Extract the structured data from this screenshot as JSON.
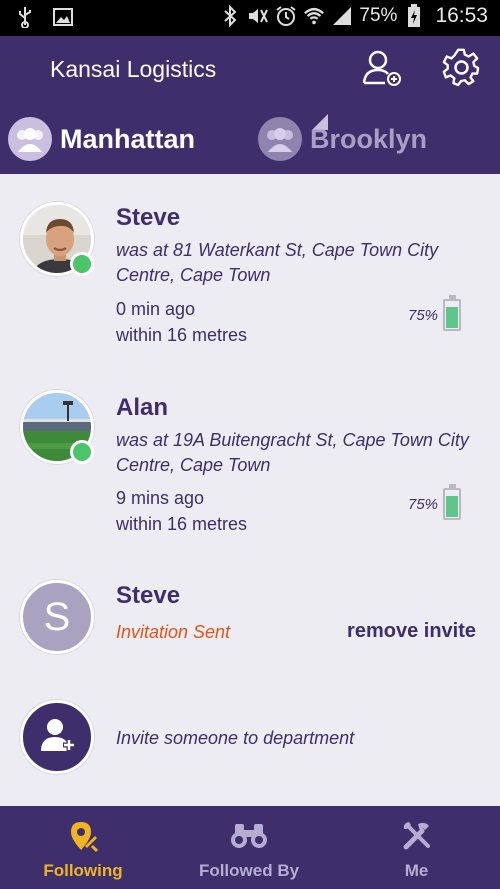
{
  "status_bar": {
    "battery": "75%",
    "time": "16:53"
  },
  "header": {
    "org_name": "Kansai Logistics"
  },
  "tabs": [
    {
      "label": "Manhattan",
      "active": true
    },
    {
      "label": "Brooklyn",
      "active": false
    }
  ],
  "people": [
    {
      "name": "Steve",
      "location": "was at 81 Waterkant St, Cape Town City Centre, Cape Town",
      "time_ago": "0 min ago",
      "accuracy": "within 16 metres",
      "battery": "75%",
      "battery_level": 0.75,
      "online": true,
      "avatar": "face-photo"
    },
    {
      "name": "Alan",
      "location": "was at 19A Buitengracht St, Cape Town City Centre, Cape Town",
      "time_ago": "9 mins ago",
      "accuracy": "within 16 metres",
      "battery": "75%",
      "battery_level": 0.75,
      "online": true,
      "avatar": "stadium-photo"
    }
  ],
  "invite": {
    "name": "Steve",
    "initial": "S",
    "status": "Invitation Sent",
    "remove_label": "remove invite"
  },
  "invite_prompt": "Invite someone to department",
  "bottom_nav": [
    {
      "label": "Following",
      "icon": "location-pin-icon",
      "active": true
    },
    {
      "label": "Followed By",
      "icon": "binoculars-icon",
      "active": false
    },
    {
      "label": "Me",
      "icon": "tools-icon",
      "active": false
    }
  ],
  "colors": {
    "primary": "#3e2e6b",
    "accent": "#f0b323",
    "online": "#4cc46a",
    "invite_status": "#e0561a",
    "background": "#ececf2"
  }
}
